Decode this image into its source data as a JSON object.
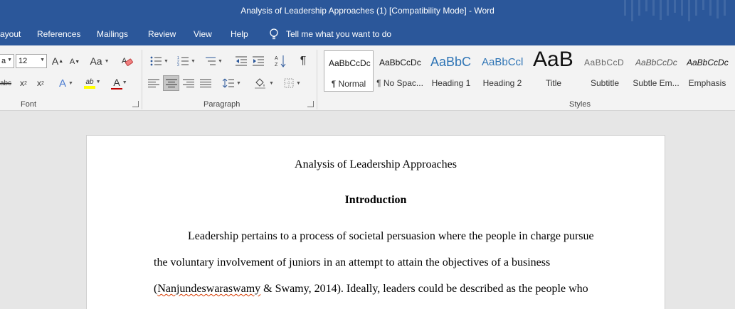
{
  "window": {
    "title": "Analysis of Leadership Approaches (1) [Compatibility Mode]  -  Word"
  },
  "menu": {
    "items": [
      "ayout",
      "References",
      "Mailings",
      "Review",
      "View",
      "Help"
    ],
    "tell_me": "Tell me what you want to do"
  },
  "ribbon": {
    "font": {
      "label": "Font",
      "font_name_value": "a",
      "font_size_value": "12",
      "grow_label": "A",
      "shrink_label": "A",
      "case_label": "Aa",
      "strike_label": "abc",
      "subscript_label": "x",
      "superscript_label": "x",
      "effects_label": "A",
      "highlight_label": "ab",
      "fontcolor_label": "A"
    },
    "paragraph": {
      "label": "Paragraph",
      "pilcrow": "¶"
    },
    "styles": {
      "label": "Styles",
      "items": [
        {
          "sample": "AaBbCcDc",
          "name": "¶ Normal"
        },
        {
          "sample": "AaBbCcDc",
          "name": "¶ No Spac..."
        },
        {
          "sample": "AaBbC",
          "name": "Heading 1"
        },
        {
          "sample": "AaBbCcl",
          "name": "Heading 2"
        },
        {
          "sample": "AaB",
          "name": "Title"
        },
        {
          "sample": "AaBbCcD",
          "name": "Subtitle"
        },
        {
          "sample": "AaBbCcDc",
          "name": "Subtle Em..."
        },
        {
          "sample": "AaBbCcDc",
          "name": "Emphasis"
        }
      ]
    }
  },
  "document": {
    "title": "Analysis of Leadership Approaches",
    "heading": "Introduction",
    "line1": "Leadership pertains to a process of societal persuasion where the people in charge pursue",
    "line2": "the voluntary involvement of juniors in an attempt to attain the objectives of a business",
    "line3_open": "(",
    "line3_misspelled": "Nanjundeswaraswamy",
    "line3_rest": " & Swamy, 2014). Ideally, leaders could be described as the people who"
  },
  "colors": {
    "word_blue": "#2b579a",
    "font_color_red": "#c00000",
    "highlight_yellow": "#ffff00",
    "heading_blue": "#2e74b5",
    "spellcheck_red": "#d83b01"
  }
}
